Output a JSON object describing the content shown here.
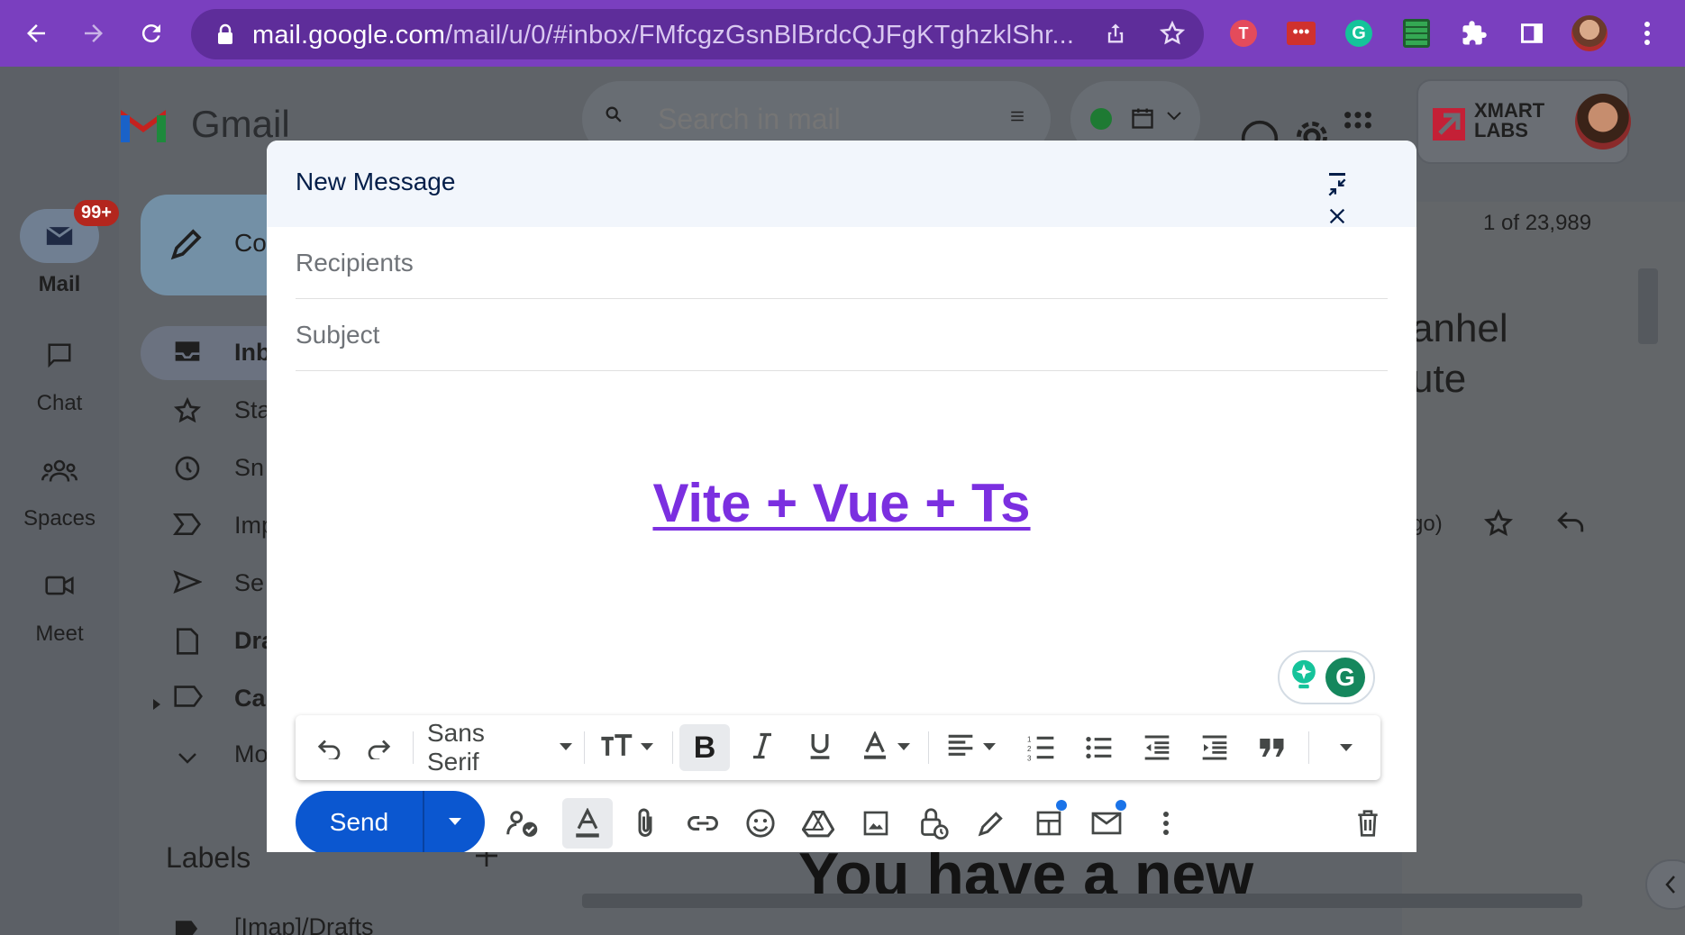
{
  "browser": {
    "url_domain": "mail.google.com",
    "url_path": "/mail/u/0/#inbox/FMfcgzGsnBlBrdcQJFgKTghzklShr...",
    "extensions": [
      "todoist-icon",
      "dots-extension-icon",
      "grammarly-icon",
      "sheets-extension-icon",
      "puzzle-icon",
      "sidepanel-icon",
      "profile-avatar",
      "kebab-menu-icon"
    ]
  },
  "gmail": {
    "logo_text": "Gmail",
    "search_placeholder": "Search in mail",
    "rail": {
      "mail": "Mail",
      "mail_badge": "99+",
      "chat": "Chat",
      "spaces": "Spaces",
      "meet": "Meet"
    },
    "compose_label": "Co",
    "nav": [
      "Inb",
      "Sta",
      "Sn",
      "Imp",
      "Se",
      "Dra",
      "Ca",
      "Mo"
    ],
    "labels_title": "Labels",
    "labels_first": "[Imap]/Drafts",
    "account_brand": "XMART LABS",
    "pagination": "1 of 23,989",
    "bg_subject_1": "anhel",
    "bg_subject_2": "ute",
    "bg_time": "go)",
    "bg_banner": "You have a new"
  },
  "compose": {
    "title": "New Message",
    "recipients_placeholder": "Recipients",
    "subject_placeholder": "Subject",
    "body_link": "Vite + Vue + Ts",
    "toolbar": {
      "font": "Sans Serif"
    },
    "send_label": "Send"
  },
  "colors": {
    "chrome": "#7a3fbf",
    "send": "#0b57d0",
    "link": "#7b2fe0"
  }
}
